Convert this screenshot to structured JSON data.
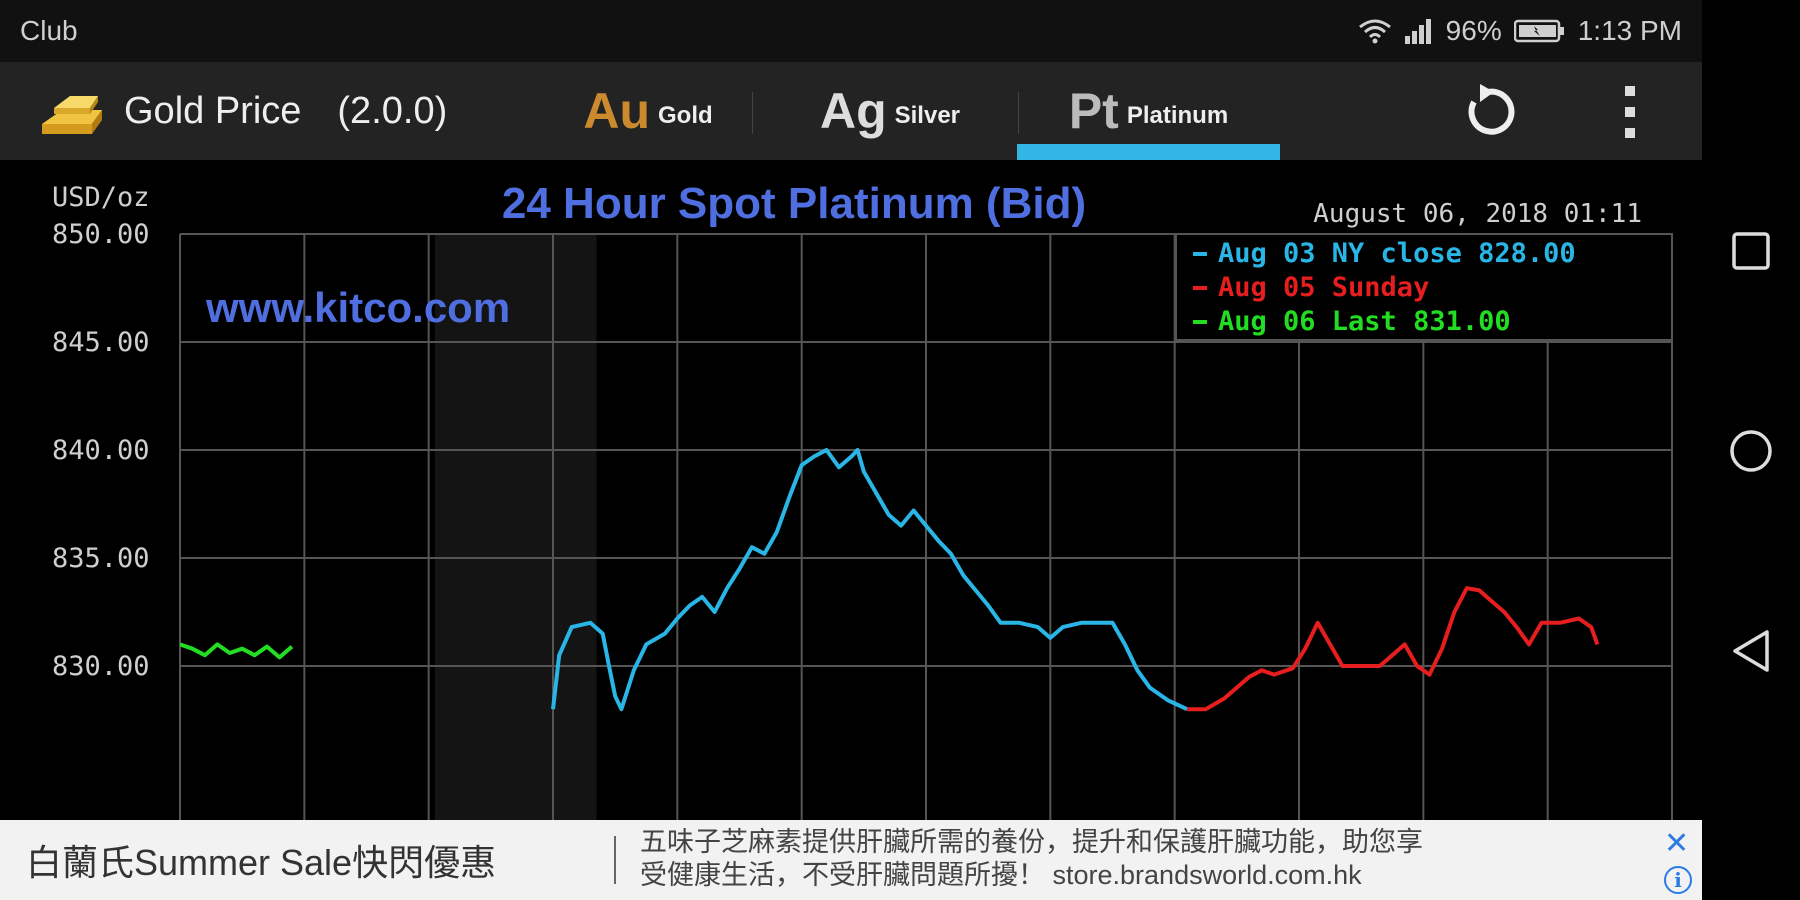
{
  "status_bar": {
    "carrier": "Club",
    "battery": "96%",
    "time": "1:13 PM"
  },
  "app_bar": {
    "title": "Gold Price",
    "version": "(2.0.0)",
    "tabs": [
      {
        "symbol": "Au",
        "name": "Gold",
        "color": "#cc8a2e",
        "selected": false
      },
      {
        "symbol": "Ag",
        "name": "Silver",
        "color": "#dddddd",
        "selected": false
      },
      {
        "symbol": "Pt",
        "name": "Platinum",
        "color": "#bbbbbb",
        "selected": true
      }
    ],
    "accent": "#33b5e5",
    "icons": [
      "gold-bar-icon",
      "refresh-icon",
      "more-vert-icon"
    ]
  },
  "chart_data": {
    "type": "line",
    "title": "24 Hour Spot Platinum (Bid)",
    "ylabel": "USD/oz",
    "timestamp": "August 06, 2018 01:11",
    "watermark": "www.kitco.com",
    "ylim": [
      828,
      850
    ],
    "yticks": [
      "850.00",
      "845.00",
      "840.00",
      "835.00",
      "830.00"
    ],
    "ytick_values": [
      850,
      845,
      840,
      835,
      830
    ],
    "xlim": [
      0,
      24
    ],
    "legend_position": "top-right",
    "grid": true,
    "shaded_region": [
      4.1,
      6.7
    ],
    "series": [
      {
        "name": "Aug 03 NY close 828.00",
        "color": "#29b6e6",
        "points": [
          [
            6.0,
            828.0
          ],
          [
            6.1,
            830.5
          ],
          [
            6.3,
            831.8
          ],
          [
            6.6,
            832.0
          ],
          [
            6.8,
            831.5
          ],
          [
            6.9,
            830.0
          ],
          [
            7.0,
            828.6
          ],
          [
            7.1,
            828.0
          ],
          [
            7.3,
            829.8
          ],
          [
            7.5,
            831.0
          ],
          [
            7.8,
            831.5
          ],
          [
            8.0,
            832.2
          ],
          [
            8.2,
            832.8
          ],
          [
            8.4,
            833.2
          ],
          [
            8.6,
            832.5
          ],
          [
            8.8,
            833.6
          ],
          [
            9.0,
            834.5
          ],
          [
            9.2,
            835.5
          ],
          [
            9.4,
            835.2
          ],
          [
            9.6,
            836.2
          ],
          [
            9.8,
            837.8
          ],
          [
            10.0,
            839.3
          ],
          [
            10.2,
            839.7
          ],
          [
            10.4,
            840.0
          ],
          [
            10.6,
            839.2
          ],
          [
            10.8,
            839.7
          ],
          [
            10.9,
            840.0
          ],
          [
            11.0,
            839.0
          ],
          [
            11.2,
            838.0
          ],
          [
            11.4,
            837.0
          ],
          [
            11.6,
            836.5
          ],
          [
            11.8,
            837.2
          ],
          [
            12.0,
            836.5
          ],
          [
            12.2,
            835.8
          ],
          [
            12.4,
            835.2
          ],
          [
            12.6,
            834.2
          ],
          [
            12.8,
            833.5
          ],
          [
            13.0,
            832.8
          ],
          [
            13.2,
            832.0
          ],
          [
            13.5,
            832.0
          ],
          [
            13.8,
            831.8
          ],
          [
            14.0,
            831.3
          ],
          [
            14.2,
            831.8
          ],
          [
            14.5,
            832.0
          ],
          [
            14.8,
            832.0
          ],
          [
            15.0,
            832.0
          ],
          [
            15.2,
            831.0
          ],
          [
            15.4,
            829.8
          ],
          [
            15.6,
            829.0
          ],
          [
            15.9,
            828.4
          ],
          [
            16.2,
            828.0
          ]
        ]
      },
      {
        "name": "Aug 05 Sunday",
        "color": "#e61e1e",
        "points": [
          [
            16.2,
            828.0
          ],
          [
            16.5,
            828.0
          ],
          [
            16.8,
            828.5
          ],
          [
            17.0,
            829.0
          ],
          [
            17.2,
            829.5
          ],
          [
            17.4,
            829.8
          ],
          [
            17.6,
            829.6
          ],
          [
            17.9,
            829.9
          ],
          [
            18.1,
            830.8
          ],
          [
            18.3,
            832.0
          ],
          [
            18.5,
            831.0
          ],
          [
            18.7,
            830.0
          ],
          [
            19.0,
            830.0
          ],
          [
            19.3,
            830.0
          ],
          [
            19.5,
            830.5
          ],
          [
            19.7,
            831.0
          ],
          [
            19.9,
            830.0
          ],
          [
            20.1,
            829.6
          ],
          [
            20.3,
            830.8
          ],
          [
            20.5,
            832.5
          ],
          [
            20.7,
            833.6
          ],
          [
            20.9,
            833.5
          ],
          [
            21.1,
            833.0
          ],
          [
            21.3,
            832.5
          ],
          [
            21.5,
            831.8
          ],
          [
            21.7,
            831.0
          ],
          [
            21.9,
            832.0
          ],
          [
            22.2,
            832.0
          ],
          [
            22.5,
            832.2
          ],
          [
            22.7,
            831.8
          ],
          [
            22.8,
            831.0
          ]
        ]
      },
      {
        "name": "Aug 06 Last 831.00",
        "color": "#22dd22",
        "points": [
          [
            0.0,
            831.0
          ],
          [
            0.2,
            830.8
          ],
          [
            0.4,
            830.5
          ],
          [
            0.6,
            831.0
          ],
          [
            0.8,
            830.6
          ],
          [
            1.0,
            830.8
          ],
          [
            1.2,
            830.5
          ],
          [
            1.4,
            830.9
          ],
          [
            1.6,
            830.4
          ],
          [
            1.8,
            830.9
          ]
        ]
      }
    ]
  },
  "ad": {
    "headline": "白蘭氏Summer Sale快閃優惠",
    "line1": "五味子芝麻素提供肝臟所需的養份，提升和保護肝臟功能，助您享",
    "line2": "受健康生活，不受肝臟問題所擾！ store.brandsworld.com.hk",
    "close_symbol": "✕",
    "info_symbol": "i"
  }
}
